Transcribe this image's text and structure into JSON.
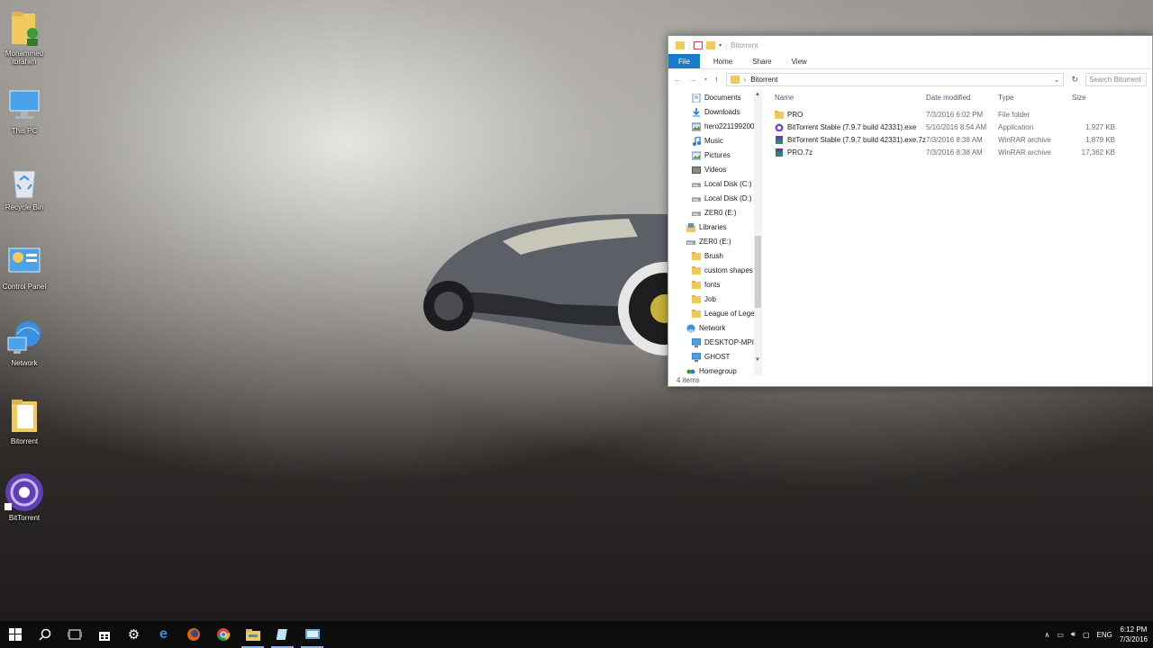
{
  "desktop": {
    "icons": [
      {
        "label": "Mohammed\nIbrahim",
        "icon": "user-folder-icon"
      },
      {
        "label": "This PC",
        "icon": "this-pc-icon"
      },
      {
        "label": "Recycle Bin",
        "icon": "recycle-bin-icon"
      },
      {
        "label": "Control Panel",
        "icon": "control-panel-icon"
      },
      {
        "label": "Network",
        "icon": "network-icon"
      },
      {
        "label": "Bitorrent",
        "icon": "folder-icon"
      },
      {
        "label": "BitTorrent",
        "icon": "bittorrent-icon"
      }
    ]
  },
  "explorer": {
    "title": "Bitorrent",
    "ribbon_tabs": [
      "File",
      "Home",
      "Share",
      "View"
    ],
    "address_path": "Bitorrent",
    "search_placeholder": "Search Bitorrent",
    "nav_items": [
      {
        "label": "Documents",
        "icon": "documents-icon",
        "indent": 2
      },
      {
        "label": "Downloads",
        "icon": "downloads-icon",
        "indent": 2
      },
      {
        "label": "hero221199200",
        "icon": "image-icon",
        "indent": 2
      },
      {
        "label": "Music",
        "icon": "music-icon",
        "indent": 2
      },
      {
        "label": "Pictures",
        "icon": "pictures-icon",
        "indent": 2
      },
      {
        "label": "Videos",
        "icon": "videos-icon",
        "indent": 2
      },
      {
        "label": "Local Disk (C:)",
        "icon": "drive-icon",
        "indent": 2
      },
      {
        "label": "Local Disk (D:)",
        "icon": "drive-icon",
        "indent": 2
      },
      {
        "label": "ZER0 (E:)",
        "icon": "drive-icon",
        "indent": 2
      },
      {
        "label": "Libraries",
        "icon": "libraries-icon",
        "indent": 1
      },
      {
        "label": "ZER0 (E:)",
        "icon": "drive-icon",
        "indent": 1
      },
      {
        "label": "Brush",
        "icon": "folder-icon",
        "indent": 2
      },
      {
        "label": "custom shapes",
        "icon": "folder-icon",
        "indent": 2
      },
      {
        "label": "fonts",
        "icon": "folder-icon",
        "indent": 2
      },
      {
        "label": "Job",
        "icon": "folder-icon",
        "indent": 2
      },
      {
        "label": "League of Lege",
        "icon": "folder-icon",
        "indent": 2
      },
      {
        "label": "Network",
        "icon": "network-icon",
        "indent": 1
      },
      {
        "label": "DESKTOP-MPI",
        "icon": "computer-icon",
        "indent": 2
      },
      {
        "label": "GHOST",
        "icon": "computer-icon",
        "indent": 2
      },
      {
        "label": "Homegroup",
        "icon": "homegroup-icon",
        "indent": 1
      }
    ],
    "columns": {
      "name": "Name",
      "date": "Date modified",
      "type": "Type",
      "size": "Size"
    },
    "files": [
      {
        "name": "PRO",
        "date": "7/3/2016 6:02 PM",
        "type": "File folder",
        "size": "",
        "icon": "folder-icon"
      },
      {
        "name": "BitTorrent Stable (7.9.7 build 42331).exe",
        "date": "5/10/2016 8:54 AM",
        "type": "Application",
        "size": "1,927 KB",
        "icon": "bittorrent-icon"
      },
      {
        "name": "BitTorrent Stable (7.9.7 build 42331).exe.7z",
        "date": "7/3/2016 8:38 AM",
        "type": "WinRAR archive",
        "size": "1,879 KB",
        "icon": "winrar-icon"
      },
      {
        "name": "PRO.7z",
        "date": "7/3/2016 8:38 AM",
        "type": "WinRAR archive",
        "size": "17,362 KB",
        "icon": "winrar-icon"
      }
    ],
    "status": "4 items"
  },
  "taskbar": {
    "items": [
      "start-icon",
      "search-icon",
      "task-view-icon",
      "store-icon",
      "settings-icon",
      "edge-icon",
      "firefox-icon",
      "chrome-icon",
      "file-explorer-icon",
      "notepad-icon",
      "remote-desktop-icon"
    ],
    "language": "ENG",
    "time": "6:12 PM",
    "date": "7/3/2016"
  },
  "colors": {
    "accent": "#1979ca",
    "taskbar": "#0c0c0c",
    "folder": "#f2c95c"
  }
}
